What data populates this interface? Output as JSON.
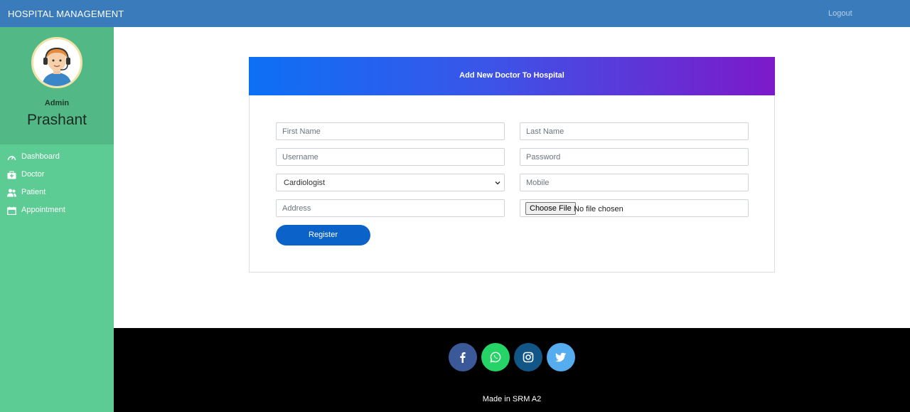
{
  "navbar": {
    "brand": "HOSPITAL MANAGEMENT",
    "logout": "Logout"
  },
  "sidebar": {
    "role": "Admin",
    "username": "Prashant",
    "items": [
      {
        "label": "Dashboard",
        "icon": "speedometer-icon"
      },
      {
        "label": "Doctor",
        "icon": "briefcase-medical-icon"
      },
      {
        "label": "Patient",
        "icon": "users-icon"
      },
      {
        "label": "Appointment",
        "icon": "calendar-icon"
      }
    ]
  },
  "form": {
    "title": "Add New Doctor To Hospital",
    "first_name_placeholder": "First Name",
    "last_name_placeholder": "Last Name",
    "username_placeholder": "Username",
    "password_placeholder": "Password",
    "department_selected": "Cardiologist",
    "mobile_placeholder": "Mobile",
    "address_placeholder": "Address",
    "file_button": "Choose File",
    "file_status": "No file chosen",
    "register_label": "Register"
  },
  "footer": {
    "social": [
      {
        "icon": "facebook-icon",
        "color": "#3b5998"
      },
      {
        "icon": "whatsapp-icon",
        "color": "#25d366"
      },
      {
        "icon": "instagram-icon",
        "color": "#125688"
      },
      {
        "icon": "twitter-icon",
        "color": "#55acee"
      }
    ],
    "credit": "Made in SRM A2"
  },
  "colors": {
    "navbar": "#3a7bbb",
    "sidebar": "#5ccb94",
    "sidebar_profile": "#52b986",
    "header_gradient_start": "#0c70f5",
    "header_gradient_end": "#7d19c9",
    "register_button": "#0b63c9",
    "footer": "#000000"
  }
}
